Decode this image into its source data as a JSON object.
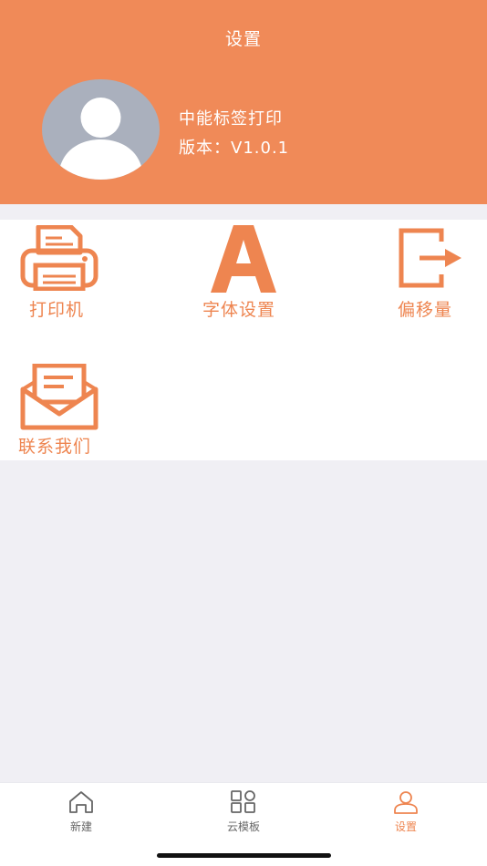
{
  "header": {
    "title": "设置",
    "app_name": "中能标签打印",
    "version": "版本：V1.0.1"
  },
  "settings": {
    "items": [
      {
        "label": "打印机",
        "icon": "printer-icon"
      },
      {
        "label": "字体设置",
        "icon": "font-a-icon"
      },
      {
        "label": "偏移量",
        "icon": "offset-exit-icon"
      },
      {
        "label": "联系我们",
        "icon": "envelope-icon"
      }
    ]
  },
  "tabbar": {
    "tabs": [
      {
        "label": "新建",
        "icon": "home-icon",
        "active": false
      },
      {
        "label": "云模板",
        "icon": "grid-icon",
        "active": false
      },
      {
        "label": "设置",
        "icon": "user-icon",
        "active": true
      }
    ]
  },
  "colors": {
    "accent": "#f08a58",
    "icon": "#ee8550",
    "background": "#f0eff4",
    "inactive_tab": "#666666"
  }
}
